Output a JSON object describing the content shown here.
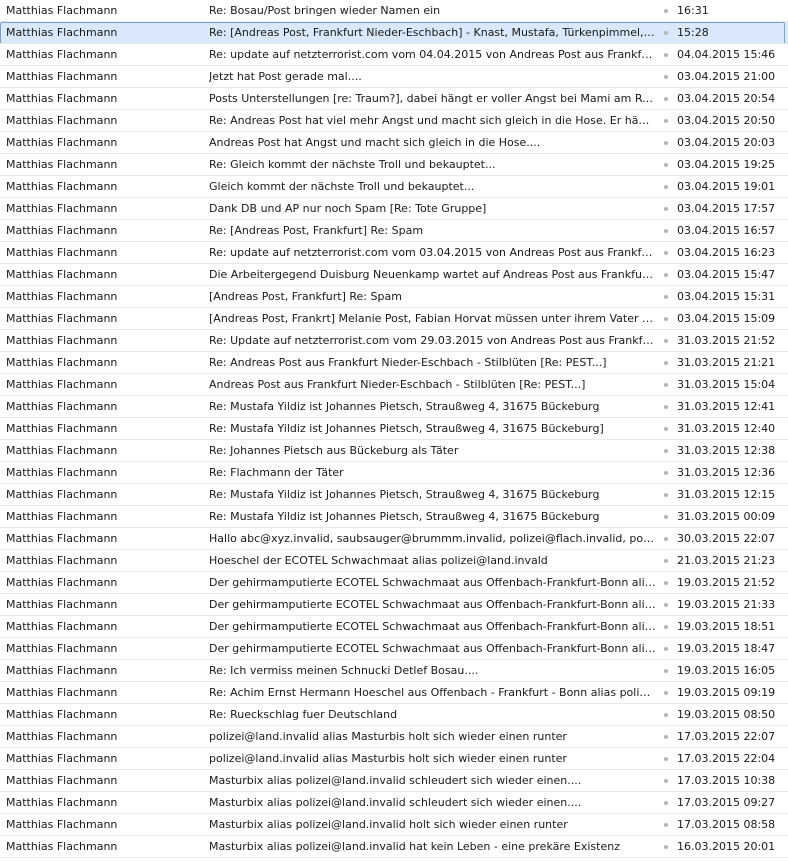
{
  "selected_index": 1,
  "messages": [
    {
      "sender": "Matthias Flachmann",
      "subject": "Re: Bosau/Post bringen wieder Namen ein",
      "date": "16:31"
    },
    {
      "sender": "Matthias Flachmann",
      "subject": "Re: [Andreas Post, Frankfurt Nieder-Eschbach] - Knast, Mustafa, Türkenpimmel, Ar...",
      "date": "15:28"
    },
    {
      "sender": "Matthias Flachmann",
      "subject": "Re: update auf netzterrorist.com vom 04.04.2015 von Andreas Post aus Frankfurt Ni...",
      "date": "04.04.2015 15:46"
    },
    {
      "sender": "Matthias Flachmann",
      "subject": "Jetzt hat Post gerade mal....",
      "date": "03.04.2015 21:00"
    },
    {
      "sender": "Matthias Flachmann",
      "subject": "Posts Unterstellungen [re: Traum?], dabei hängt er voller Angst bei Mami am Rockz...",
      "date": "03.04.2015 20:54"
    },
    {
      "sender": "Matthias Flachmann",
      "subject": "Re: Andreas Post hat  viel mehr Angst und macht sich gleich in die Hose. Er hängt j...",
      "date": "03.04.2015 20:50"
    },
    {
      "sender": "Matthias Flachmann",
      "subject": "Andreas Post hat  Angst und macht sich gleich in die Hose....",
      "date": "03.04.2015 20:03"
    },
    {
      "sender": "Matthias Flachmann",
      "subject": "Re: Gleich kommt der nächste Troll und bekauptet...",
      "date": "03.04.2015 19:25"
    },
    {
      "sender": "Matthias Flachmann",
      "subject": "Gleich kommt der nächste Troll und bekauptet...",
      "date": "03.04.2015 19:01"
    },
    {
      "sender": "Matthias Flachmann",
      "subject": "Dank DB und AP nur noch Spam [Re: Tote Gruppe]",
      "date": "03.04.2015 17:57"
    },
    {
      "sender": "Matthias Flachmann",
      "subject": "Re: [Andreas Post, Frankfurt] Re: Spam",
      "date": "03.04.2015 16:57"
    },
    {
      "sender": "Matthias Flachmann",
      "subject": "Re: update auf netzterrorist.com vom 03.04.2015 von Andreas Post aus Frankfurt Ni...",
      "date": "03.04.2015 16:23"
    },
    {
      "sender": "Matthias Flachmann",
      "subject": "Die Arbeitergegend Duisburg Neuenkamp wartet auf Andreas Post aus Frankfurt Ni...",
      "date": "03.04.2015 15:47"
    },
    {
      "sender": "Matthias Flachmann",
      "subject": "[Andreas Post, Frankfurt] Re: Spam",
      "date": "03.04.2015 15:31"
    },
    {
      "sender": "Matthias Flachmann",
      "subject": "[Andreas Post, Frankrt] Melanie Post, Fabian Horvat müssen unter ihrem Vater leide...",
      "date": "03.04.2015 15:09"
    },
    {
      "sender": "Matthias Flachmann",
      "subject": "Re: Update auf netzterrorist.com vom 29.03.2015 von Andreas Post aus Frankfurt Ni...",
      "date": "31.03.2015 21:52"
    },
    {
      "sender": "Matthias Flachmann",
      "subject": "Re: Andreas Post  aus Frankfurt  Nieder-Eschbach - Stilblüten [Re: PEST...]",
      "date": "31.03.2015 21:21"
    },
    {
      "sender": "Matthias Flachmann",
      "subject": "Andreas Post  aus Frankfurt  Nieder-Eschbach - Stilblüten [Re: PEST...]",
      "date": "31.03.2015 15:04"
    },
    {
      "sender": "Matthias Flachmann",
      "subject": "Re: Mustafa Yildiz ist Johannes Pietsch, Straußweg 4, 31675 Bückeburg",
      "date": "31.03.2015 12:41"
    },
    {
      "sender": "Matthias Flachmann",
      "subject": "Re: Mustafa Yildiz ist Johannes Pietsch, Straußweg 4, 31675 Bückeburg]",
      "date": "31.03.2015 12:40"
    },
    {
      "sender": "Matthias Flachmann",
      "subject": "Re: Johannes Pietsch aus Bückeburg als Täter",
      "date": "31.03.2015 12:38"
    },
    {
      "sender": "Matthias Flachmann",
      "subject": "Re: Flachmann der Täter",
      "date": "31.03.2015 12:36"
    },
    {
      "sender": "Matthias Flachmann",
      "subject": "Re: Mustafa Yildiz ist Johannes Pietsch, Straußweg 4, 31675 Bückeburg",
      "date": "31.03.2015 12:15"
    },
    {
      "sender": "Matthias Flachmann",
      "subject": "Re: Mustafa Yildiz ist Johannes Pietsch, Straußweg 4, 31675 Bückeburg",
      "date": "31.03.2015 00:09"
    },
    {
      "sender": "Matthias Flachmann",
      "subject": "Hallo abc@xyz.invalid, saubsauger@brummm.invalid, polizei@flach.invalid, polizei...",
      "date": "30.03.2015 22:07"
    },
    {
      "sender": "Matthias Flachmann",
      "subject": "Hoeschel der ECOTEL Schwachmaat alias polizei@land.invald",
      "date": "21.03.2015 21:23"
    },
    {
      "sender": "Matthias Flachmann",
      "subject": "Der gehirmamputierte ECOTEL Schwachmaat aus Offenbach-Frankfurt-Bonn alias ...",
      "date": "19.03.2015 21:52"
    },
    {
      "sender": "Matthias Flachmann",
      "subject": "Der gehirmamputierte ECOTEL Schwachmaat aus Offenbach-Frankfurt-Bonn alias ...",
      "date": "19.03.2015 21:33"
    },
    {
      "sender": "Matthias Flachmann",
      "subject": "Der gehirmamputierte ECOTEL Schwachmaat aus Offenbach-Frankfurt-Bonn alias ...",
      "date": "19.03.2015 18:51"
    },
    {
      "sender": "Matthias Flachmann",
      "subject": "Der gehirmamputierte ECOTEL Schwachmaat aus Offenbach-Frankfurt-Bonn alias ...",
      "date": "19.03.2015 18:47"
    },
    {
      "sender": "Matthias Flachmann",
      "subject": "Re: Ich vermiss meinen Schnucki Detlef Bosau....",
      "date": "19.03.2015 16:05"
    },
    {
      "sender": "Matthias Flachmann",
      "subject": "Re: Achim Ernst Hermann Hoeschel aus Offenbach - Frankfurt - Bonn alias polizei...",
      "date": "19.03.2015 09:19"
    },
    {
      "sender": "Matthias Flachmann",
      "subject": "Re: Rueckschlag fuer Deutschland",
      "date": "19.03.2015 08:50"
    },
    {
      "sender": "Matthias Flachmann",
      "subject": "polizei@land.invalid alias Masturbis holt sich wieder einen runter",
      "date": "17.03.2015 22:07"
    },
    {
      "sender": "Matthias Flachmann",
      "subject": "polizei@land.invalid alias Masturbis holt sich wieder einen runter",
      "date": "17.03.2015 22:04"
    },
    {
      "sender": "Matthias Flachmann",
      "subject": "Masturbix alias polizei@land.invalid schleudert sich wieder einen....",
      "date": "17.03.2015 10:38"
    },
    {
      "sender": "Matthias Flachmann",
      "subject": "Masturbix alias polizei@land.invalid schleudert sich wieder einen....",
      "date": "17.03.2015 09:27"
    },
    {
      "sender": "Matthias Flachmann",
      "subject": "Masturbix alias polizei@land.invalid holt sich wieder einen runter",
      "date": "17.03.2015 08:58"
    },
    {
      "sender": "Matthias Flachmann",
      "subject": "Masturbix alias polizei@land.invalid hat kein Leben - eine prekäre Existenz",
      "date": "16.03.2015 20:01"
    }
  ]
}
